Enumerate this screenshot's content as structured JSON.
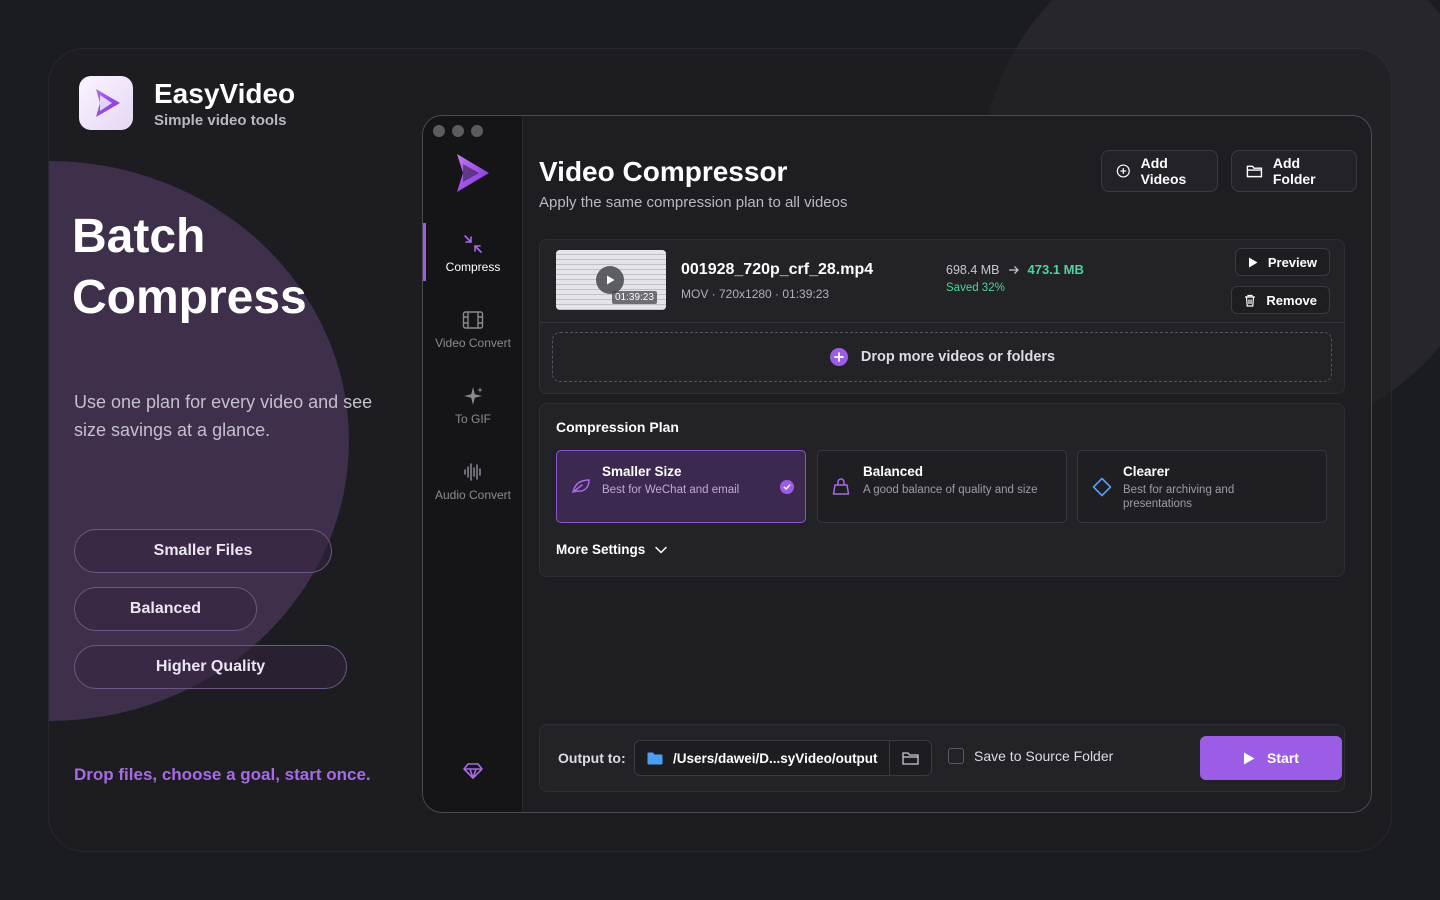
{
  "brand": {
    "name": "EasyVideo",
    "subtitle": "Simple video tools"
  },
  "promo": {
    "headline_line1": "Batch",
    "headline_line2": "Compress",
    "description": "Use one plan for every video and see size savings at a glance.",
    "pills": [
      "Smaller Files",
      "Balanced",
      "Higher Quality"
    ],
    "tagline": "Drop files, choose a goal, start once."
  },
  "sidebar": {
    "items": [
      {
        "label": "Compress",
        "icon": "compress-icon",
        "active": true
      },
      {
        "label": "Video Convert",
        "icon": "film-icon",
        "active": false
      },
      {
        "label": "To GIF",
        "icon": "sparkle-icon",
        "active": false
      },
      {
        "label": "Audio Convert",
        "icon": "waveform-icon",
        "active": false
      }
    ]
  },
  "header": {
    "title": "Video Compressor",
    "subtitle": "Apply the same compression plan to all videos",
    "add_videos_label": "Add Videos",
    "add_folder_label": "Add Folder"
  },
  "file": {
    "name": "001928_720p_crf_28.mp4",
    "meta": "MOV · 720x1280 · 01:39:23",
    "thumb_time": "01:39:23",
    "original_size": "698.4 MB",
    "new_size": "473.1 MB",
    "saved": "Saved 32%",
    "preview_label": "Preview",
    "remove_label": "Remove"
  },
  "drop": {
    "label": "Drop more videos or folders"
  },
  "plan": {
    "title": "Compression Plan",
    "options": [
      {
        "name": "Smaller Size",
        "desc": "Best for WeChat and email",
        "icon": "leaf-icon",
        "selected": true
      },
      {
        "name": "Balanced",
        "desc": "A good balance of quality and size",
        "icon": "scale-icon",
        "selected": false
      },
      {
        "name": "Clearer",
        "desc": "Best for archiving and presentations",
        "icon": "diamond-icon",
        "selected": false
      }
    ],
    "more_settings_label": "More Settings"
  },
  "output": {
    "label": "Output to:",
    "path": "/Users/dawei/D...syVideo/output",
    "save_to_source_label": "Save to Source Folder",
    "save_to_source_checked": false,
    "start_label": "Start"
  },
  "colors": {
    "accent": "#9b5de5",
    "success": "#4ed49a",
    "background": "#1b1c21"
  }
}
